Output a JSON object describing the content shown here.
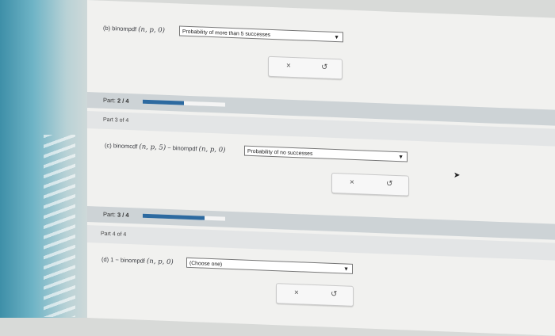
{
  "partb": {
    "letter": "(b)",
    "expr": "binompdf",
    "args": "(n, p, 0)",
    "select_value": "Probability of more than 5 successes"
  },
  "progress_2": {
    "label": "Part:",
    "value": "2 / 4",
    "fraction": 0.5
  },
  "part3_header": "Part 3 of 4",
  "partc": {
    "letter": "(c)",
    "expr1": "binomcdf",
    "args1": "(n, p, 5)",
    "minus": "−",
    "expr2": "binompdf",
    "args2": "(n, p, 0)",
    "select_value": "Probability of no successes"
  },
  "progress_3": {
    "label": "Part:",
    "value": "3 / 4",
    "fraction": 0.75
  },
  "part4_header": "Part 4 of 4",
  "partd": {
    "letter": "(d)",
    "one": "1",
    "minus": "−",
    "expr": "binompdf",
    "args": "(n, p, 0)",
    "select_value": "(Choose one)"
  },
  "buttons": {
    "clear": "×",
    "undo": "↺"
  },
  "icons": [
    "close-icon",
    "undo-icon",
    "chevron-down-icon",
    "cursor-icon"
  ]
}
